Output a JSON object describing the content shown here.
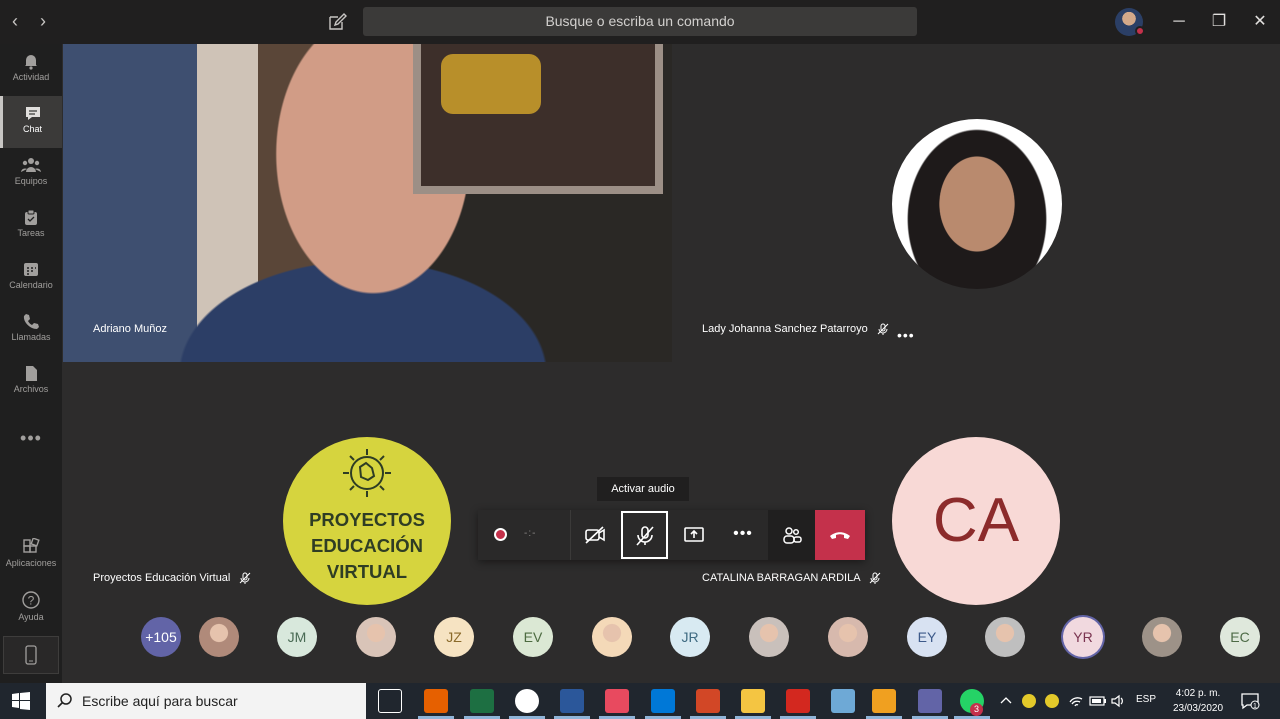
{
  "titlebar": {
    "search_placeholder": "Busque o escriba un comando",
    "back_icon": "‹",
    "forward_icon": "›",
    "minimize": "─",
    "restore": "❐",
    "close": "✕"
  },
  "rail": {
    "items": [
      {
        "label": "Actividad",
        "icon": "bell-icon"
      },
      {
        "label": "Chat",
        "icon": "chat-icon"
      },
      {
        "label": "Equipos",
        "icon": "teams-icon"
      },
      {
        "label": "Tareas",
        "icon": "tasks-icon"
      },
      {
        "label": "Calendario",
        "icon": "calendar-icon"
      },
      {
        "label": "Llamadas",
        "icon": "phone-icon"
      },
      {
        "label": "Archivos",
        "icon": "files-icon"
      }
    ],
    "more": "•••",
    "apps_label": "Aplicaciones",
    "help_label": "Ayuda",
    "help_icon": "?"
  },
  "stage": {
    "video1_name": "Adriano Muñoz",
    "lady_name": "Lady Johanna Sanchez Patarroyo",
    "lady_more": "•••",
    "proj_name": "Proyectos Educación Virtual",
    "proj_logo_lines": [
      "PROYECTOS",
      "EDUCACIÓN",
      "VIRTUAL"
    ],
    "ca_name": "CATALINA BARRAGAN ARDILA",
    "ca_initials": "CA"
  },
  "controls": {
    "timer": "-:-",
    "tooltip": "Activar audio",
    "more": "•••"
  },
  "participants": [
    {
      "text": "+105",
      "bg": "#6264a7",
      "fg": "#ffffff"
    },
    {
      "text": "",
      "bg": "#b08a7a",
      "fg": "#ffffff",
      "photo": true
    },
    {
      "text": "JM",
      "bg": "#d8e8dc",
      "fg": "#4a6b55"
    },
    {
      "text": "",
      "bg": "#d9c4b8",
      "fg": "#ffffff",
      "photo": true
    },
    {
      "text": "JZ",
      "bg": "#f6e3c2",
      "fg": "#8a6a2a"
    },
    {
      "text": "EV",
      "bg": "#dbe8d4",
      "fg": "#4d6b41"
    },
    {
      "text": "",
      "bg": "#f4d9b8",
      "fg": "#ffffff",
      "photo": true
    },
    {
      "text": "JR",
      "bg": "#d8eaf2",
      "fg": "#3f6b82"
    },
    {
      "text": "",
      "bg": "#c9c0bb",
      "fg": "#ffffff",
      "photo": true
    },
    {
      "text": "",
      "bg": "#d7b9ad",
      "fg": "#ffffff",
      "photo": true
    },
    {
      "text": "EY",
      "bg": "#d8e2f2",
      "fg": "#3d5a8a"
    },
    {
      "text": "",
      "bg": "#bfbfbf",
      "fg": "#ffffff",
      "photo": true
    },
    {
      "text": "YR",
      "bg": "#f1d9df",
      "fg": "#7a3450"
    },
    {
      "text": "",
      "bg": "#9d9288",
      "fg": "#ffffff",
      "photo": true
    },
    {
      "text": "EC",
      "bg": "#dfe8dc",
      "fg": "#4e6b47"
    }
  ],
  "taskbar": {
    "search_placeholder": "Escribe aquí para buscar",
    "lang": "ESP",
    "time": "4:02 p. m.",
    "date": "23/03/2020",
    "whatsapp_badge": "3",
    "apps": [
      "task-view-icon",
      "firefox-icon",
      "excel-icon",
      "chrome-icon",
      "word-icon",
      "paint-icon",
      "edge-icon",
      "powerpoint-icon",
      "explorer-icon",
      "acrobat-icon",
      "notes-icon",
      "media-icon",
      "teams-icon",
      "whatsapp-icon"
    ]
  },
  "colors": {
    "accent": "#6264a7",
    "hangup": "#c4314b",
    "stage_bg": "#2d2c2c"
  }
}
